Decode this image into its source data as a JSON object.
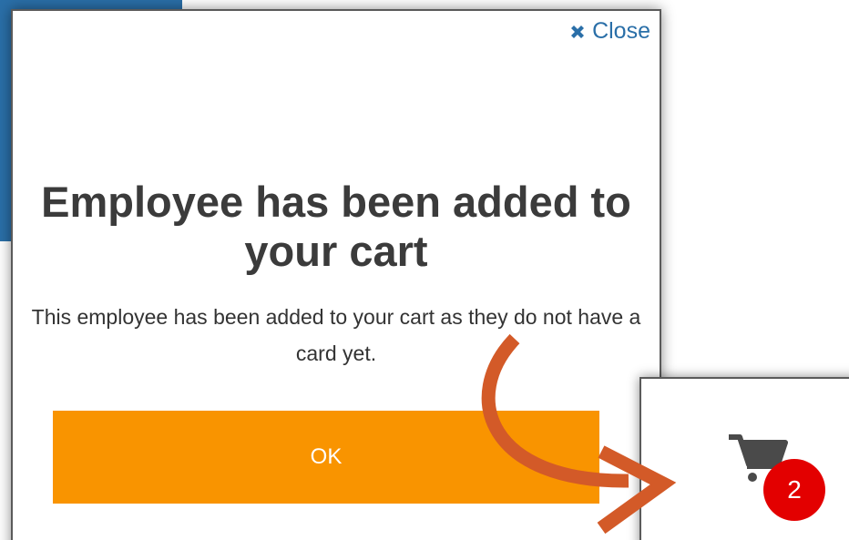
{
  "modal": {
    "close_label": "Close",
    "title": "Employee has been added to your cart",
    "message": "This employee has been added to your cart as they do not have a card yet.",
    "ok_label": "OK",
    "ok_color": "#f99400"
  },
  "cart": {
    "badge_count": "2",
    "badge_color": "#e30000"
  },
  "annotation": {
    "arrow_color": "#d35a28"
  },
  "colors": {
    "link": "#2a6fa8",
    "background_accent": "#2a6fa8"
  }
}
